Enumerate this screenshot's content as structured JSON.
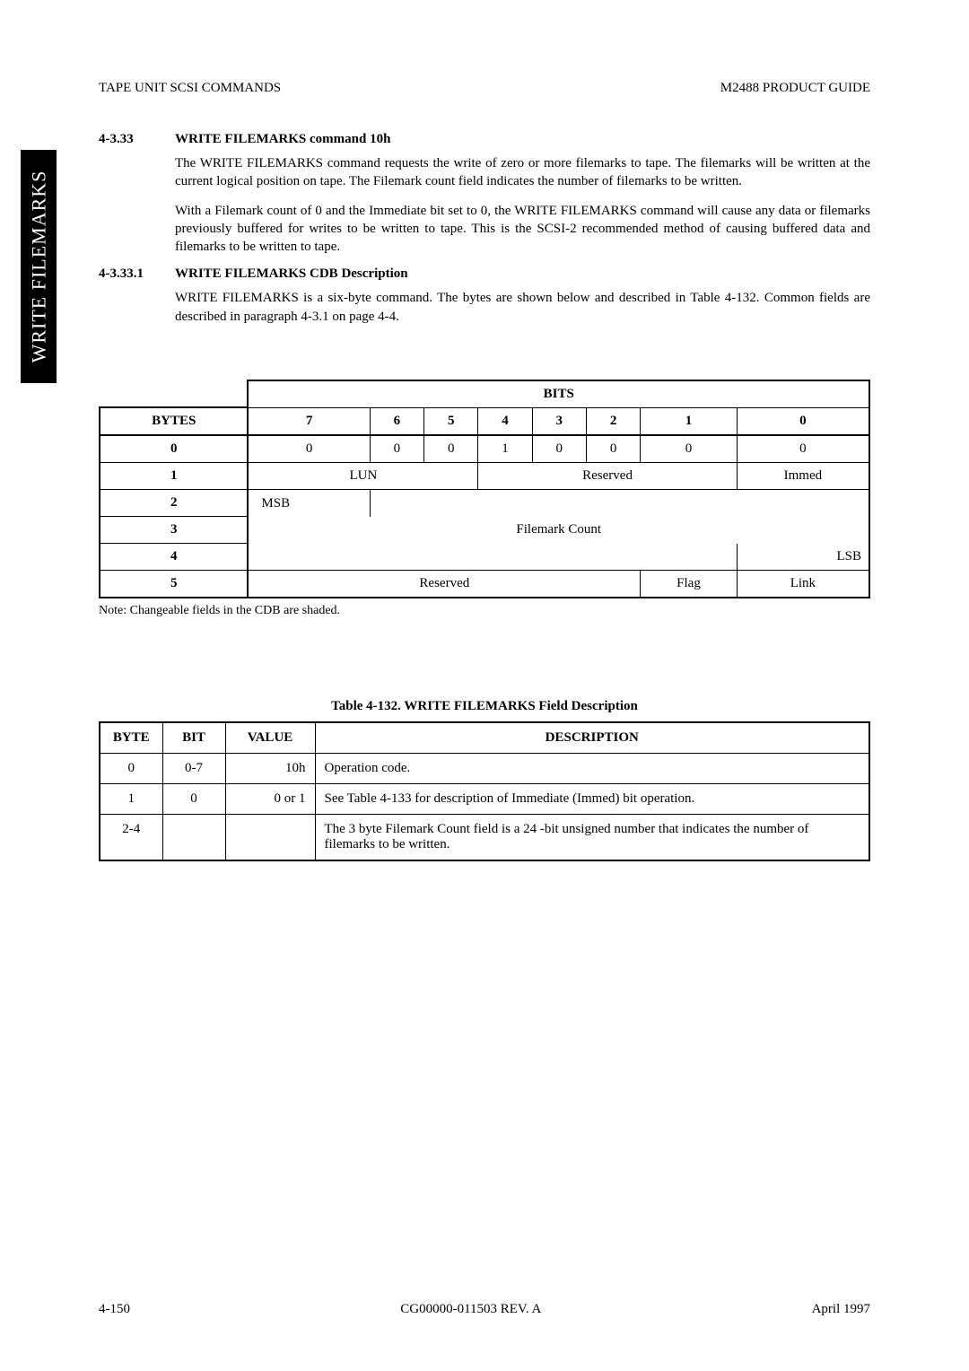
{
  "header": {
    "left": "TAPE UNIT SCSI COMMANDS",
    "right": "M2488 PRODUCT GUIDE"
  },
  "side_tab": "WRITE FILEMARKS",
  "section1": {
    "num": "4-3.33",
    "title": "WRITE FILEMARKS command 10h",
    "p1": "The WRITE FILEMARKS command requests the write of zero or more filemarks to tape. The filemarks will be written at the current logical position on tape. The Filemark count field indicates the number of filemarks to be written.",
    "p2": "With a Filemark count of 0 and the Immediate bit set to 0, the WRITE FILEMARKS command will cause any data or filemarks previously buffered for writes to be written to tape. This is the SCSI-2 recommended method of causing buffered data and filemarks to be written to tape."
  },
  "section2": {
    "num": "4-3.33.1",
    "title": "WRITE FILEMARKS CDB Description",
    "p1": "WRITE FILEMARKS is a six-byte command. The bytes are shown below and described in Table 4-132. Common fields are described in paragraph 4-3.1 on page 4-4."
  },
  "cdb": {
    "bits_label": "BITS",
    "bytes_label": "BYTES",
    "bit_cols": [
      "7",
      "6",
      "5",
      "4",
      "3",
      "2",
      "1",
      "0"
    ],
    "rows": [
      {
        "byte": "0",
        "cells": [
          "0",
          "0",
          "0",
          "1",
          "0",
          "0",
          "0",
          "0"
        ]
      },
      {
        "byte": "1",
        "lun": "LUN",
        "reserved": "Reserved",
        "immed": "Immed"
      },
      {
        "byte": "2",
        "msb": "MSB"
      },
      {
        "byte": "3",
        "filemark": "Filemark Count"
      },
      {
        "byte": "4",
        "lsb": "LSB"
      },
      {
        "byte": "5",
        "reserved": "Reserved",
        "flag": "Flag",
        "link": "Link"
      }
    ],
    "note": "Note: Changeable fields in the CDB are shaded."
  },
  "desc_caption": "Table 4-132.   WRITE FILEMARKS Field Description",
  "desc_table": {
    "headers": [
      "BYTE",
      "BIT",
      "VALUE",
      "DESCRIPTION"
    ],
    "rows": [
      {
        "byte": "0",
        "bit": "0-7",
        "value": "10h",
        "desc": "Operation code."
      },
      {
        "byte": "1",
        "bit": "0",
        "value": "0 or 1",
        "desc": "See Table 4-133 for description of Immediate (Immed) bit operation."
      },
      {
        "byte": "2-4",
        "bit": "",
        "value": "",
        "desc": "The 3 byte Filemark Count field is a 24 -bit unsigned number that indicates the number of filemarks to be written."
      }
    ]
  },
  "footer": {
    "left": "4-150",
    "center": "CG00000-011503 REV. A",
    "right": "April 1997"
  }
}
